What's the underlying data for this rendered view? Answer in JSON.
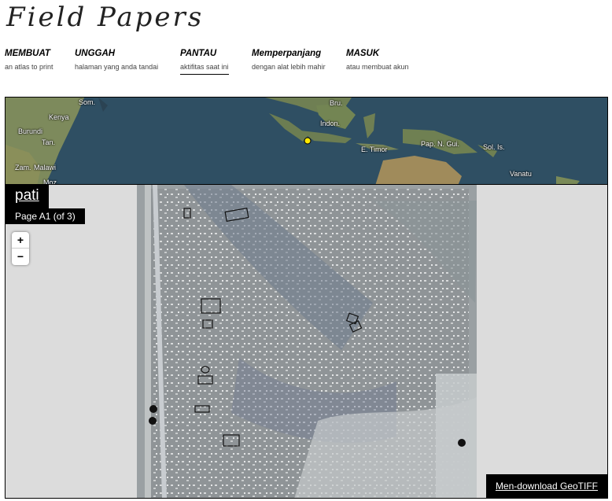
{
  "site": {
    "logo": "Field Papers"
  },
  "nav": [
    {
      "title": "MEMBUAT",
      "subtitle": "an atlas to print"
    },
    {
      "title": "UNGGAH",
      "subtitle": "halaman yang anda tandai"
    },
    {
      "title": "PANTAU",
      "subtitle": "aktifitas saat ini"
    },
    {
      "title": "Memperpanjang",
      "subtitle": "dengan alat lebih mahir"
    },
    {
      "title": "MASUK",
      "subtitle": "atau membuat akun"
    }
  ],
  "nav_active": "PANTAU",
  "overview_places": [
    "Som.",
    "Kenya",
    "Burundi",
    "Tan.",
    "Zam.",
    "Malawi",
    "Moz.",
    "Bru.",
    "Indon.",
    "E. Timor",
    "Pap. N. Gui.",
    "Sol. Is.",
    "Vanatu"
  ],
  "atlas": {
    "title": "pati",
    "page_label": "Page A1 (of 3)",
    "download_label": "Men-download GeoTIFF"
  },
  "zoom": {
    "in": "+",
    "out": "−"
  },
  "colors": {
    "ocean": "#2f4f63",
    "land": "#7d8a5c",
    "marker": "#ffe800",
    "panel": "#000000",
    "map_bg": "#dcdcdc"
  }
}
